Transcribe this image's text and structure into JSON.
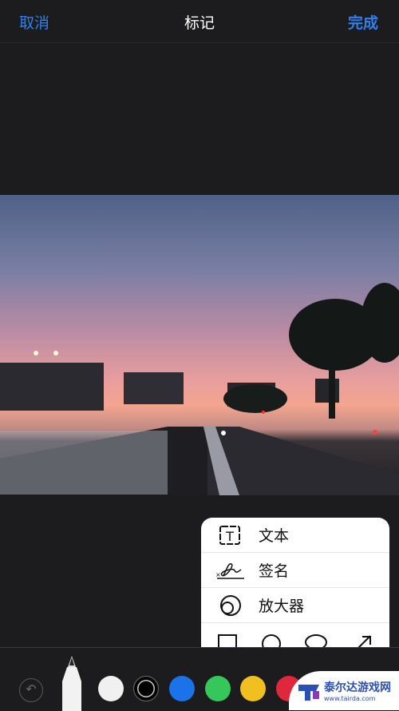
{
  "nav": {
    "cancel": "取消",
    "title": "标记",
    "done": "完成"
  },
  "markup_menu": {
    "items": [
      {
        "label": "文本",
        "icon": "text-box-icon"
      },
      {
        "label": "签名",
        "icon": "signature-icon"
      },
      {
        "label": "放大器",
        "icon": "magnifier-icon"
      }
    ],
    "shapes": [
      "square-icon",
      "circle-icon",
      "speech-bubble-icon",
      "arrow-icon"
    ]
  },
  "toolbar": {
    "tool": "pen",
    "colors": [
      "#f0f0f0",
      "#000000",
      "#1a73e8",
      "#34c759",
      "#f0c020",
      "#e0283c"
    ],
    "selected_color": "#000000"
  },
  "watermark": {
    "name": "泰尔达游戏网",
    "url": "www.tairda.com"
  }
}
